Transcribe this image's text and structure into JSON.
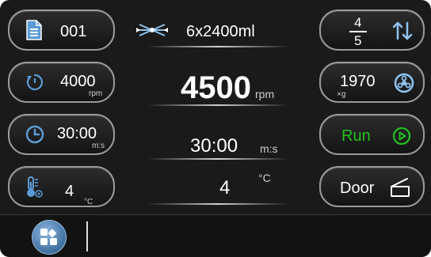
{
  "program": {
    "number": "001"
  },
  "rotor": {
    "capacity": "6x2400ml"
  },
  "speed": {
    "setting": "4000",
    "unit": "rpm",
    "actual": "4500",
    "actual_unit": "rpm"
  },
  "time": {
    "setting": "30:00",
    "unit": "m:s",
    "actual": "30:00",
    "actual_unit": "m:s"
  },
  "temperature": {
    "setting": "4",
    "unit": "°C",
    "actual": "4",
    "actual_unit": "°C"
  },
  "acceleration": {
    "accel": "4",
    "decel": "5"
  },
  "rcf": {
    "value": "1970",
    "unit": "×g"
  },
  "run_button": {
    "label": "Run"
  },
  "door_button": {
    "label": "Door"
  },
  "colors": {
    "panel": "#1a1a1a",
    "run_green": "#22c21f",
    "border": "#9a9a9a",
    "menu_blue": "#5b8fc2"
  },
  "icons": [
    "document-icon",
    "rotor-icon",
    "speed-dial-icon",
    "clock-icon",
    "thermometer-icon",
    "up-down-arrows-icon",
    "rcf-icon",
    "play-circle-icon",
    "door-open-icon",
    "menu-apps-icon"
  ]
}
